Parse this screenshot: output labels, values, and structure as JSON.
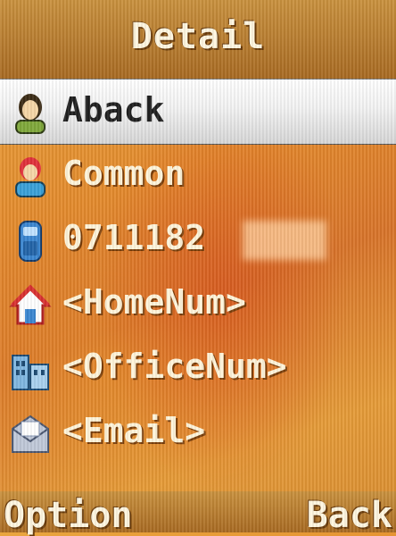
{
  "header": {
    "title": "Detail"
  },
  "contact": {
    "name": "Aback",
    "group": "Common",
    "mobile": "0711182",
    "home": "<HomeNum>",
    "office": "<OfficeNum>",
    "email": "<Email>"
  },
  "softkeys": {
    "left": "Option",
    "right": "Back"
  },
  "icons": [
    "person-icon",
    "group-icon",
    "mobile-phone-icon",
    "home-icon",
    "office-building-icon",
    "email-icon"
  ],
  "colors": {
    "bar": "#b07428",
    "highlight": "#f0f0f0",
    "background": "#e38a2c"
  }
}
